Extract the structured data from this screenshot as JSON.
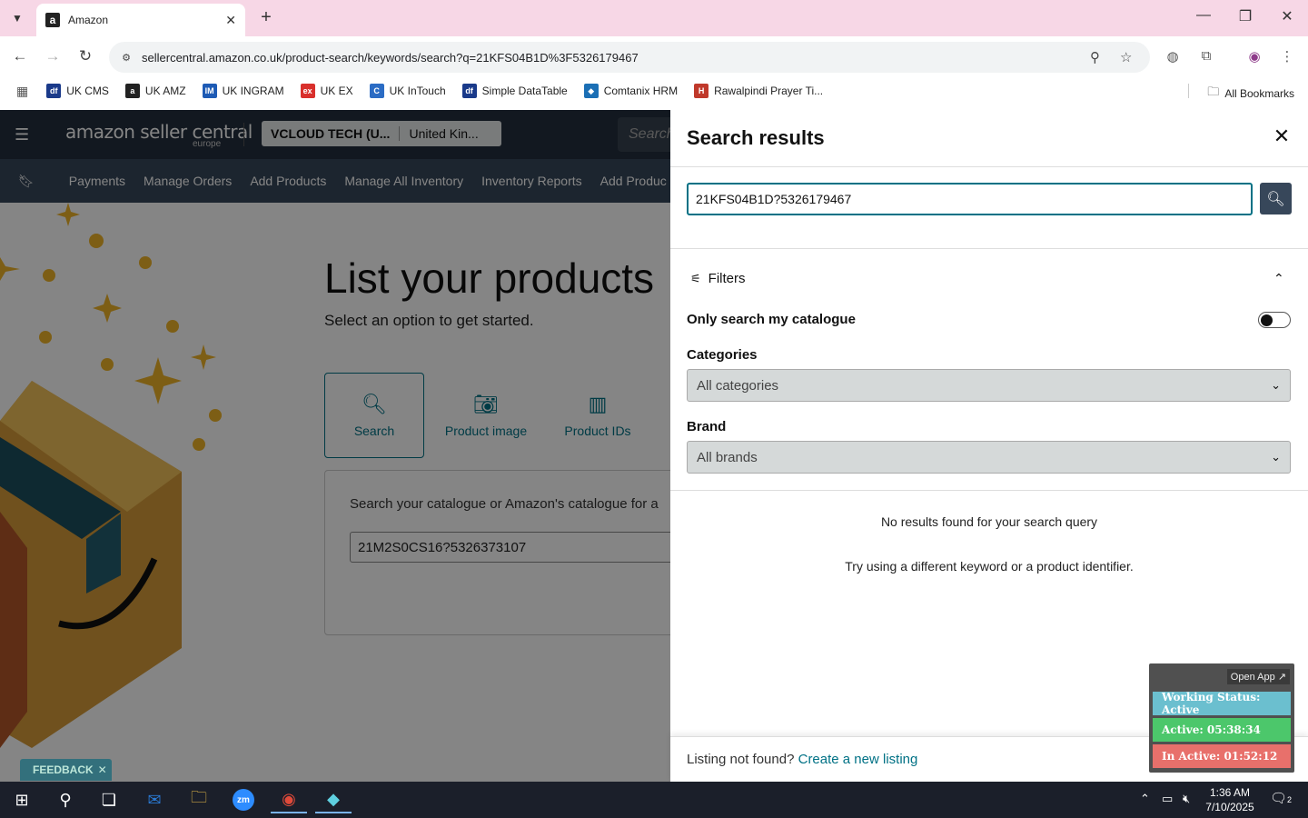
{
  "browser": {
    "tab_title": "Amazon",
    "url": "sellercentral.amazon.co.uk/product-search/keywords/search?q=21KFS04B1D%3F5326179467",
    "bookmarks": [
      {
        "label": "UK CMS",
        "color": "#1a3a8a",
        "glyph": "df"
      },
      {
        "label": "UK AMZ",
        "color": "#222222",
        "glyph": "a"
      },
      {
        "label": "UK INGRAM",
        "color": "#1e5bb5",
        "glyph": "IM"
      },
      {
        "label": "UK EX",
        "color": "#d9302c",
        "glyph": "ex"
      },
      {
        "label": "UK InTouch",
        "color": "#2b6cc4",
        "glyph": "C"
      },
      {
        "label": "Simple DataTable",
        "color": "#1a3a8a",
        "glyph": "df"
      },
      {
        "label": "Comtanix HRM",
        "color": "#1b6fb5",
        "glyph": "◆"
      },
      {
        "label": "Rawalpindi Prayer Ti...",
        "color": "#c0392b",
        "glyph": "H"
      }
    ],
    "all_bookmarks": "All Bookmarks"
  },
  "seller": {
    "logo": "amazon seller central",
    "logo_sub": "europe",
    "account_name": "VCLOUD TECH (U...",
    "account_country": "United Kin...",
    "search_placeholder": "Search",
    "nav": [
      "Payments",
      "Manage Orders",
      "Add Products",
      "Manage All Inventory",
      "Inventory Reports",
      "Add Produc"
    ],
    "hero_title": "List your products",
    "hero_sub": "Select an option to get started.",
    "options": [
      "Search",
      "Product image",
      "Product IDs"
    ],
    "panel_text": "Search your catalogue or Amazon's catalogue for a",
    "panel_input": "21M2S0CS16?5326373107",
    "feedback": "FEEDBACK"
  },
  "drawer": {
    "title": "Search results",
    "query": "21KFS04B1D?5326179467",
    "filters_label": "Filters",
    "only_my_catalogue": "Only search my catalogue",
    "categories_label": "Categories",
    "categories_value": "All categories",
    "brand_label": "Brand",
    "brand_value": "All brands",
    "no_results": "No results found for your search query",
    "try_again": "Try using a different keyword or a product identifier.",
    "footer_text": "Listing not found?",
    "footer_link": "Create a new listing"
  },
  "status_widget": {
    "open_app": "Open App ↗",
    "working": "Working Status: Active",
    "active": "Active: 05:38:34",
    "inactive": "In Active: 01:52:12",
    "working_color": "#6bbfcf",
    "active_color": "#4cc76b",
    "inactive_color": "#e8706b"
  },
  "taskbar": {
    "time": "1:36 AM",
    "date": "7/10/2025",
    "notifications": "2"
  }
}
